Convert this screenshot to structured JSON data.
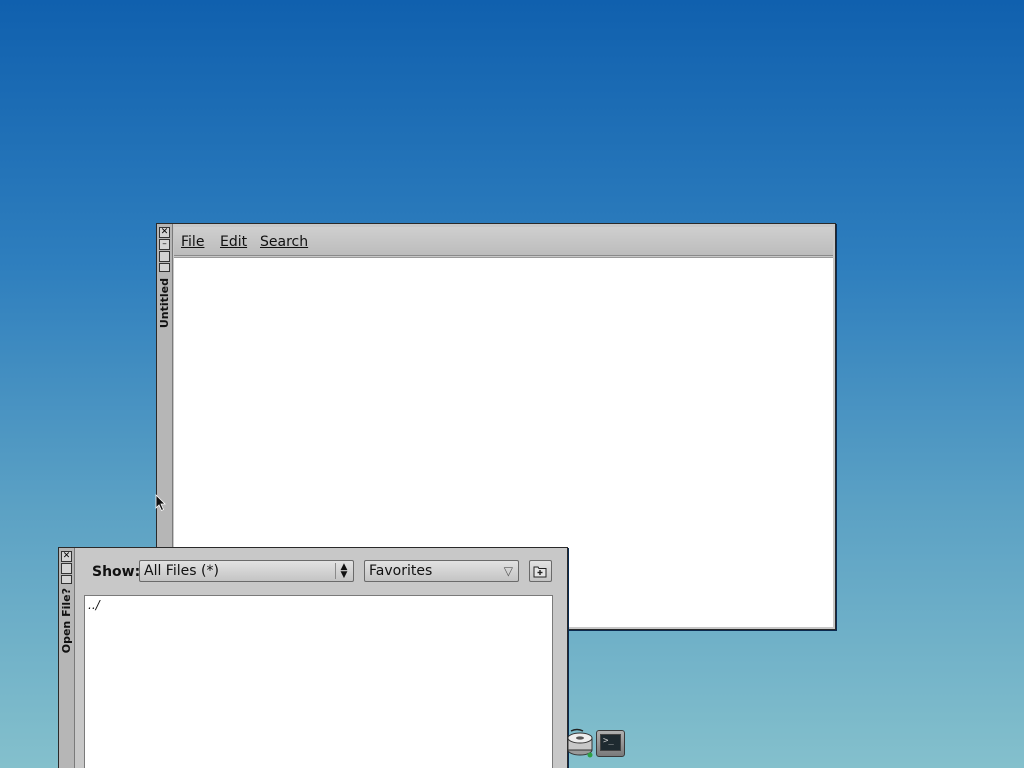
{
  "colors": {
    "desktop_top": "#1060ae",
    "desktop_bottom": "#84c0cc",
    "window_chrome": "#c8c8c8",
    "content_bg": "#ffffff"
  },
  "editor_window": {
    "title": "Untitled",
    "menu": [
      {
        "label": "File"
      },
      {
        "label": "Edit"
      },
      {
        "label": "Search"
      }
    ],
    "titlebar_buttons": [
      "close-icon",
      "minimize-icon",
      "maximize-icon",
      "shade-icon"
    ]
  },
  "open_file_dialog": {
    "title": "Open File?",
    "show_label": "Show:",
    "filter_value": "All Files (*)",
    "favorites_label": "Favorites",
    "new_folder_icon": "new-folder-icon",
    "files": [
      {
        "name": "../"
      }
    ]
  },
  "tray": {
    "icons": [
      "disk-drive-icon",
      "terminal-icon"
    ],
    "terminal_prompt": ">_"
  }
}
